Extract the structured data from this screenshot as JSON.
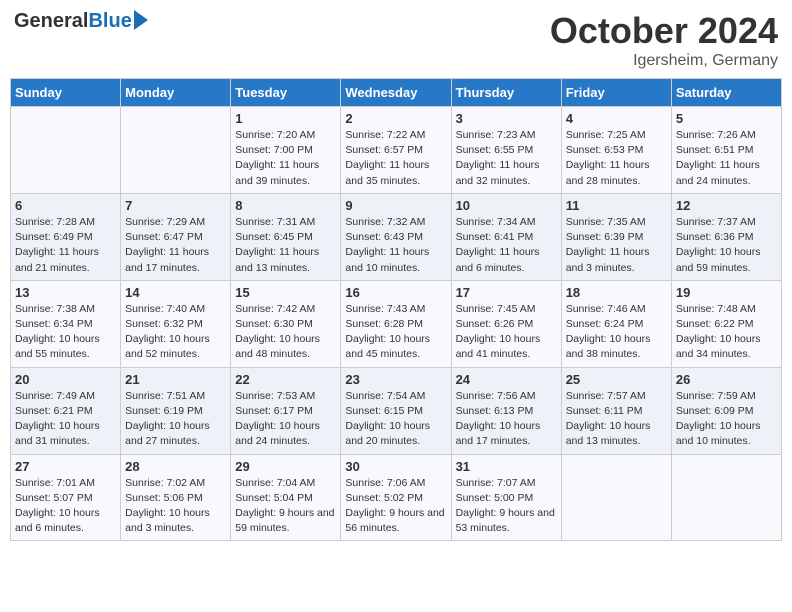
{
  "header": {
    "logo_general": "General",
    "logo_blue": "Blue",
    "month_title": "October 2024",
    "location": "Igersheim, Germany"
  },
  "days_of_week": [
    "Sunday",
    "Monday",
    "Tuesday",
    "Wednesday",
    "Thursday",
    "Friday",
    "Saturday"
  ],
  "weeks": [
    [
      {
        "day": "",
        "sunrise": "",
        "sunset": "",
        "daylight": ""
      },
      {
        "day": "",
        "sunrise": "",
        "sunset": "",
        "daylight": ""
      },
      {
        "day": "1",
        "sunrise": "Sunrise: 7:20 AM",
        "sunset": "Sunset: 7:00 PM",
        "daylight": "Daylight: 11 hours and 39 minutes."
      },
      {
        "day": "2",
        "sunrise": "Sunrise: 7:22 AM",
        "sunset": "Sunset: 6:57 PM",
        "daylight": "Daylight: 11 hours and 35 minutes."
      },
      {
        "day": "3",
        "sunrise": "Sunrise: 7:23 AM",
        "sunset": "Sunset: 6:55 PM",
        "daylight": "Daylight: 11 hours and 32 minutes."
      },
      {
        "day": "4",
        "sunrise": "Sunrise: 7:25 AM",
        "sunset": "Sunset: 6:53 PM",
        "daylight": "Daylight: 11 hours and 28 minutes."
      },
      {
        "day": "5",
        "sunrise": "Sunrise: 7:26 AM",
        "sunset": "Sunset: 6:51 PM",
        "daylight": "Daylight: 11 hours and 24 minutes."
      }
    ],
    [
      {
        "day": "6",
        "sunrise": "Sunrise: 7:28 AM",
        "sunset": "Sunset: 6:49 PM",
        "daylight": "Daylight: 11 hours and 21 minutes."
      },
      {
        "day": "7",
        "sunrise": "Sunrise: 7:29 AM",
        "sunset": "Sunset: 6:47 PM",
        "daylight": "Daylight: 11 hours and 17 minutes."
      },
      {
        "day": "8",
        "sunrise": "Sunrise: 7:31 AM",
        "sunset": "Sunset: 6:45 PM",
        "daylight": "Daylight: 11 hours and 13 minutes."
      },
      {
        "day": "9",
        "sunrise": "Sunrise: 7:32 AM",
        "sunset": "Sunset: 6:43 PM",
        "daylight": "Daylight: 11 hours and 10 minutes."
      },
      {
        "day": "10",
        "sunrise": "Sunrise: 7:34 AM",
        "sunset": "Sunset: 6:41 PM",
        "daylight": "Daylight: 11 hours and 6 minutes."
      },
      {
        "day": "11",
        "sunrise": "Sunrise: 7:35 AM",
        "sunset": "Sunset: 6:39 PM",
        "daylight": "Daylight: 11 hours and 3 minutes."
      },
      {
        "day": "12",
        "sunrise": "Sunrise: 7:37 AM",
        "sunset": "Sunset: 6:36 PM",
        "daylight": "Daylight: 10 hours and 59 minutes."
      }
    ],
    [
      {
        "day": "13",
        "sunrise": "Sunrise: 7:38 AM",
        "sunset": "Sunset: 6:34 PM",
        "daylight": "Daylight: 10 hours and 55 minutes."
      },
      {
        "day": "14",
        "sunrise": "Sunrise: 7:40 AM",
        "sunset": "Sunset: 6:32 PM",
        "daylight": "Daylight: 10 hours and 52 minutes."
      },
      {
        "day": "15",
        "sunrise": "Sunrise: 7:42 AM",
        "sunset": "Sunset: 6:30 PM",
        "daylight": "Daylight: 10 hours and 48 minutes."
      },
      {
        "day": "16",
        "sunrise": "Sunrise: 7:43 AM",
        "sunset": "Sunset: 6:28 PM",
        "daylight": "Daylight: 10 hours and 45 minutes."
      },
      {
        "day": "17",
        "sunrise": "Sunrise: 7:45 AM",
        "sunset": "Sunset: 6:26 PM",
        "daylight": "Daylight: 10 hours and 41 minutes."
      },
      {
        "day": "18",
        "sunrise": "Sunrise: 7:46 AM",
        "sunset": "Sunset: 6:24 PM",
        "daylight": "Daylight: 10 hours and 38 minutes."
      },
      {
        "day": "19",
        "sunrise": "Sunrise: 7:48 AM",
        "sunset": "Sunset: 6:22 PM",
        "daylight": "Daylight: 10 hours and 34 minutes."
      }
    ],
    [
      {
        "day": "20",
        "sunrise": "Sunrise: 7:49 AM",
        "sunset": "Sunset: 6:21 PM",
        "daylight": "Daylight: 10 hours and 31 minutes."
      },
      {
        "day": "21",
        "sunrise": "Sunrise: 7:51 AM",
        "sunset": "Sunset: 6:19 PM",
        "daylight": "Daylight: 10 hours and 27 minutes."
      },
      {
        "day": "22",
        "sunrise": "Sunrise: 7:53 AM",
        "sunset": "Sunset: 6:17 PM",
        "daylight": "Daylight: 10 hours and 24 minutes."
      },
      {
        "day": "23",
        "sunrise": "Sunrise: 7:54 AM",
        "sunset": "Sunset: 6:15 PM",
        "daylight": "Daylight: 10 hours and 20 minutes."
      },
      {
        "day": "24",
        "sunrise": "Sunrise: 7:56 AM",
        "sunset": "Sunset: 6:13 PM",
        "daylight": "Daylight: 10 hours and 17 minutes."
      },
      {
        "day": "25",
        "sunrise": "Sunrise: 7:57 AM",
        "sunset": "Sunset: 6:11 PM",
        "daylight": "Daylight: 10 hours and 13 minutes."
      },
      {
        "day": "26",
        "sunrise": "Sunrise: 7:59 AM",
        "sunset": "Sunset: 6:09 PM",
        "daylight": "Daylight: 10 hours and 10 minutes."
      }
    ],
    [
      {
        "day": "27",
        "sunrise": "Sunrise: 7:01 AM",
        "sunset": "Sunset: 5:07 PM",
        "daylight": "Daylight: 10 hours and 6 minutes."
      },
      {
        "day": "28",
        "sunrise": "Sunrise: 7:02 AM",
        "sunset": "Sunset: 5:06 PM",
        "daylight": "Daylight: 10 hours and 3 minutes."
      },
      {
        "day": "29",
        "sunrise": "Sunrise: 7:04 AM",
        "sunset": "Sunset: 5:04 PM",
        "daylight": "Daylight: 9 hours and 59 minutes."
      },
      {
        "day": "30",
        "sunrise": "Sunrise: 7:06 AM",
        "sunset": "Sunset: 5:02 PM",
        "daylight": "Daylight: 9 hours and 56 minutes."
      },
      {
        "day": "31",
        "sunrise": "Sunrise: 7:07 AM",
        "sunset": "Sunset: 5:00 PM",
        "daylight": "Daylight: 9 hours and 53 minutes."
      },
      {
        "day": "",
        "sunrise": "",
        "sunset": "",
        "daylight": ""
      },
      {
        "day": "",
        "sunrise": "",
        "sunset": "",
        "daylight": ""
      }
    ]
  ]
}
